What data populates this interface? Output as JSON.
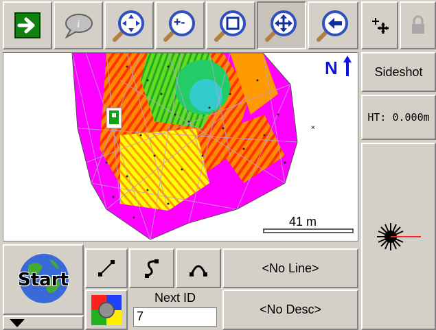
{
  "toolbar": {
    "icons": [
      "arrow-right-icon",
      "info-balloon-icon",
      "zoom-extents-icon",
      "zoom-in-out-icon",
      "zoom-window-icon",
      "pan-icon",
      "zoom-previous-icon",
      "crosshair-point-icon",
      "lock-icon"
    ]
  },
  "map": {
    "north_label": "N",
    "scale_label": "41 m"
  },
  "right_panel": {
    "mode_label": "Sideshot",
    "ht_label": "HT: 0.000m"
  },
  "bottom": {
    "start_label": "Start",
    "line_label": "<No Line>",
    "desc_label": "<No Desc>",
    "next_id_label": "Next ID",
    "next_id_value": "7"
  },
  "colors": {
    "north_blue": "#1010e0",
    "magenta": "#ff00ff",
    "orange": "#ff8800",
    "yellow": "#ffff00",
    "green": "#00cc00",
    "cyan": "#33cccc",
    "red": "#ff2020"
  }
}
